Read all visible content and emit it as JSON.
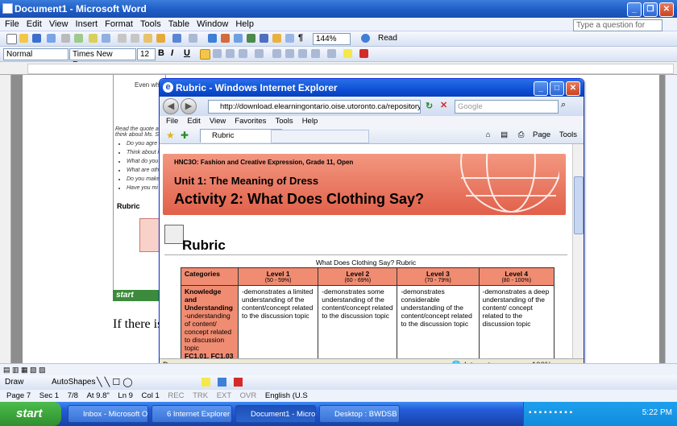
{
  "word": {
    "title": "Document1 - Microsoft Word",
    "menu": [
      "File",
      "Edit",
      "View",
      "Insert",
      "Format",
      "Tools",
      "Table",
      "Window",
      "Help"
    ],
    "ask_placeholder": "Type a question for help",
    "zoom": "144%",
    "read_label": "Read",
    "style": "Normal",
    "font": "Times New Roman",
    "font_size": "12",
    "doc_text": "If there is",
    "snippet_even": "Even whe",
    "snippet_read": "Read the quote a think about Ms. S",
    "bullets": [
      "Do you agre",
      "Think about i",
      "What do you",
      "What are oth",
      "Do you make",
      "Have you mi"
    ],
    "rubric_small": "Rubric",
    "mini_start": "start",
    "status": {
      "page": "Page 7",
      "sec": "Sec 1",
      "pages": "7/8",
      "at": "At 9.8\"",
      "ln": "Ln 9",
      "col": "Col 1",
      "rec": "REC",
      "trk": "TRK",
      "ext": "EXT",
      "ovr": "OVR",
      "lang": "English (U.S"
    },
    "draw_label": "Draw",
    "autoshapes_label": "AutoShapes"
  },
  "ie": {
    "title": "Rubric - Windows Internet Explorer",
    "address": "http://download.elearningontario.oise.utoronto.ca/repository/1181970000/",
    "search_placeholder": "Google",
    "menu": [
      "File",
      "Edit",
      "View",
      "Favorites",
      "Tools",
      "Help"
    ],
    "tab_label": "Rubric",
    "cmd_page": "Page",
    "cmd_tools": "Tools",
    "status_left": "Done",
    "status_zone": "Internet",
    "status_zoom": "100%"
  },
  "content": {
    "course": "HNC3O: Fashion and Creative Expression, Grade 11, Open",
    "unit": "Unit 1: The Meaning of Dress",
    "activity": "Activity 2: What Does Clothing Say?",
    "heading": "Rubric",
    "caption": "What Does Clothing Say? Rubric",
    "table": {
      "headers": [
        {
          "label": "Categories",
          "range": ""
        },
        {
          "label": "Level 1",
          "range": "(50 - 59%)"
        },
        {
          "label": "Level 2",
          "range": "(60 - 69%)"
        },
        {
          "label": "Level 3",
          "range": "(70 - 79%)"
        },
        {
          "label": "Level 4",
          "range": "(80 - 100%)"
        }
      ],
      "row": {
        "category": "Knowledge and Understanding",
        "category_desc": "-understanding of content/ concept related to discussion topic",
        "codes": "FC1.01, FC1.03",
        "cells": [
          "-demonstrates a limited understanding of the content/concept related to the discussion topic",
          "-demonstrates some understanding of the content/concept related to the discussion topic",
          "-demonstrates considerable understanding of the content/concept related to the discussion topic",
          "-demonstrates a deep understanding of the content/ concept related to the discussion topic"
        ]
      }
    }
  },
  "taskbar": {
    "start": "start",
    "tasks": [
      "Inbox - Microsoft Out...",
      "6 Internet Explorer",
      "Document1 - Microsof...",
      "Desktop : BWDSB"
    ],
    "clock": "5:22 PM"
  }
}
